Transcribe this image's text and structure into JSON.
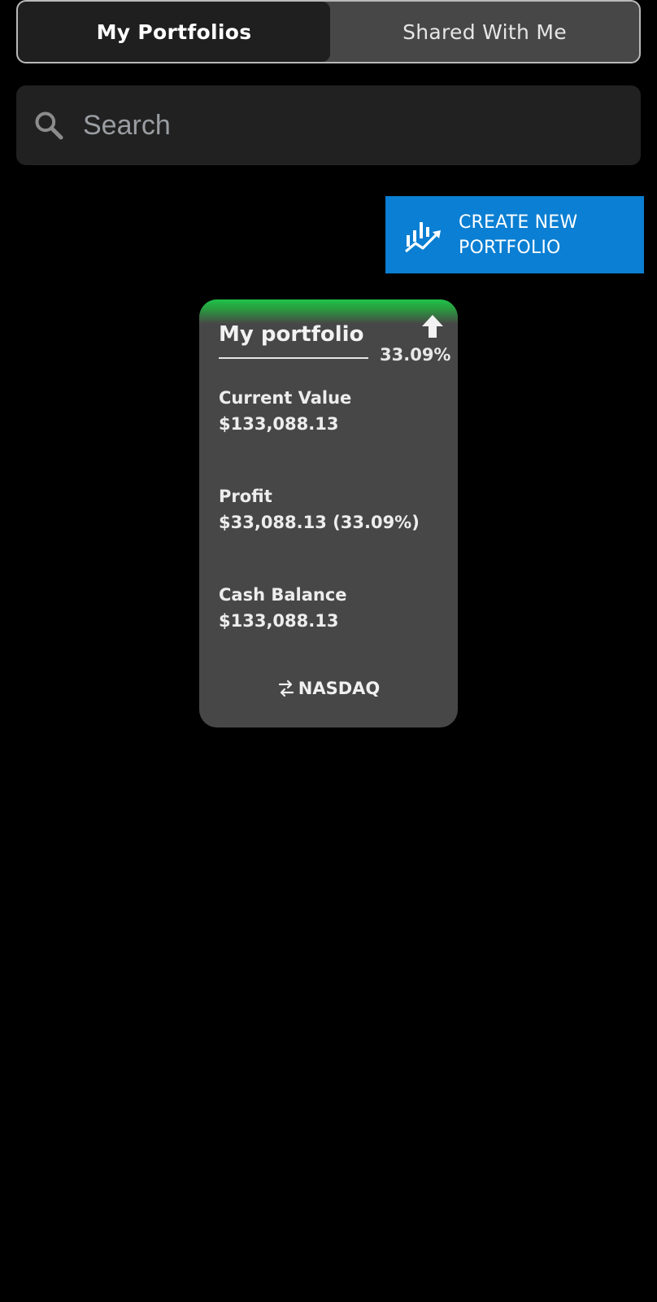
{
  "tabs": {
    "my_portfolios": "My Portfolios",
    "shared_with_me": "Shared With Me"
  },
  "search": {
    "placeholder": "Search"
  },
  "create_button": {
    "label": "CREATE NEW PORTFOLIO",
    "icon": "chart-growth-icon"
  },
  "portfolio_card": {
    "title": "My portfolio",
    "change_percent": "33.09%",
    "trend_icon": "arrow-up-icon",
    "current_value_label": "Current Value",
    "current_value": "$133,088.13",
    "profit_label": "Profit",
    "profit_value": "$33,088.13 (33.09%)",
    "cash_balance_label": "Cash Balance",
    "cash_balance_value": "$133,088.13",
    "exchange": "NASDAQ",
    "exchange_icon": "swap-icon"
  },
  "colors": {
    "background": "#000000",
    "tab_active": "#1f1f1f",
    "tab_inactive": "#474747",
    "search_bg": "#212121",
    "accent_blue": "#0a7fd3",
    "card_bg": "#474747",
    "gain_green": "#1fc24a"
  }
}
